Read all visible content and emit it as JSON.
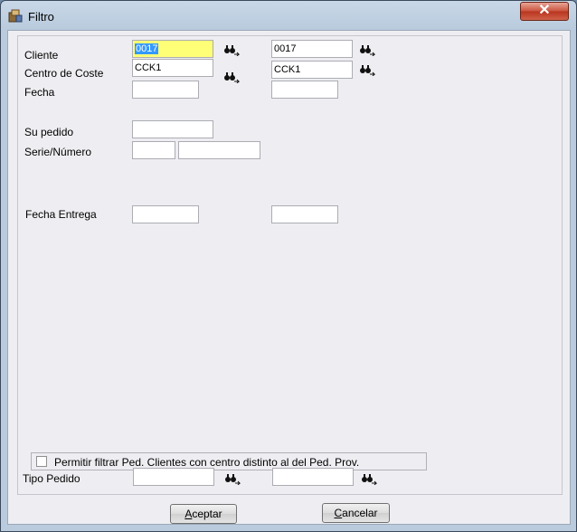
{
  "window": {
    "title": "Filtro"
  },
  "form": {
    "cliente": {
      "label": "Cliente",
      "from": "0017",
      "to": "0017"
    },
    "centro": {
      "label": "Centro de Coste",
      "from": "CCK1",
      "to": "CCK1"
    },
    "fecha": {
      "label": "Fecha",
      "from": "",
      "to": ""
    },
    "su_pedido": {
      "label": "Su pedido",
      "value": ""
    },
    "serie": {
      "label": "Serie/Número",
      "serie": "",
      "numero": ""
    },
    "fecha_entrega": {
      "label": "Fecha Entrega",
      "from": "",
      "to": ""
    },
    "permitir": {
      "label": "Permitir filtrar Ped. Clientes con centro distinto al del Ped. Prov.",
      "checked": false
    },
    "tipo_pedido": {
      "label": "Tipo Pedido",
      "from": "",
      "to": ""
    }
  },
  "buttons": {
    "accept_first": "A",
    "accept_rest": "ceptar",
    "cancel_first": "C",
    "cancel_rest": "ancelar"
  },
  "colors": {
    "highlight_field": "#ffff77",
    "selection": "#3399ff",
    "close_button": "#c9523c"
  },
  "icons": {
    "title": "filter-app-icon",
    "search": "binoculars-icon",
    "close": "close-icon"
  }
}
